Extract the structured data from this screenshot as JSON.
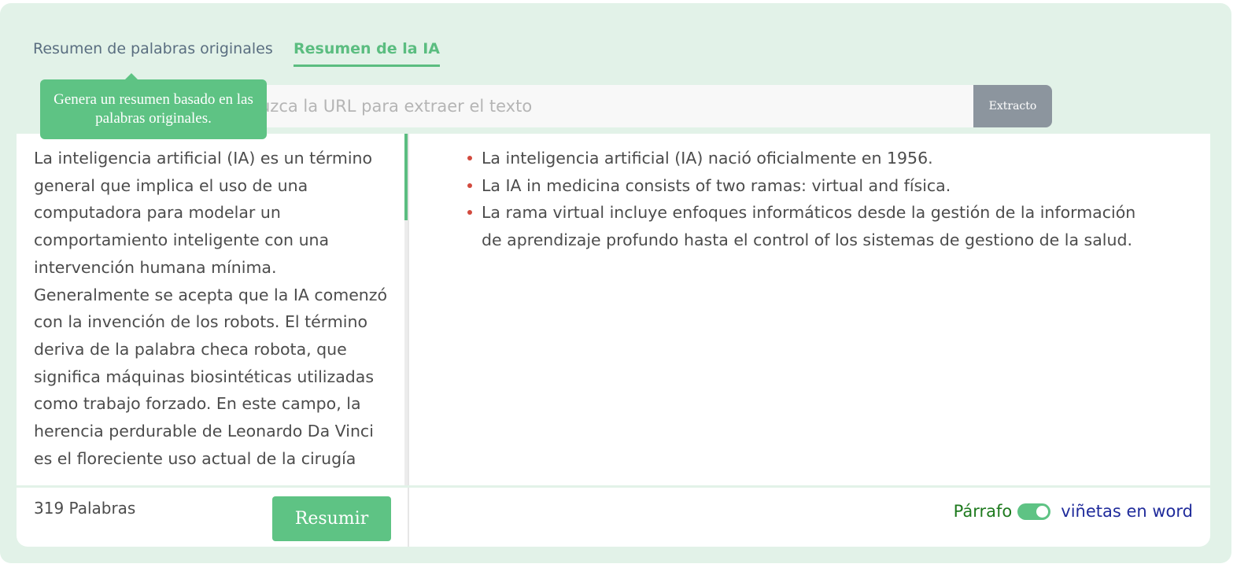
{
  "tabs": {
    "original_label": "Resumen de palabras originales",
    "ai_label": "Resumen de la IA",
    "active": "Resumen de la IA"
  },
  "tooltip": {
    "text": "Genera un resumen basado en las palabras originales."
  },
  "url_bar": {
    "placeholder": "uzca la URL para extraer el texto",
    "value": "",
    "extract_label": "Extracto"
  },
  "original": {
    "text": "La inteligencia artificial (IA) es un término general que implica el uso de una computadora para modelar un comportamiento inteligente con una intervención humana mínima. Generalmente se acepta que la IA comenzó con la invención de los robots. El término deriva de la palabra checa robota, que significa máquinas biosintéticas utilizadas como trabajo forzado. En este campo, la herencia perdurable de Leonardo Da Vinci es el floreciente uso actual de la cirugía",
    "word_count": "319 Palabras",
    "summarize_label": "Resumir"
  },
  "summary": {
    "items": [
      "La inteligencia artificial (IA) nació oficialmente en 1956.",
      "La IA in medicina consists of two ramas: virtual and física.",
      "La rama virtual incluye enfoques informáticos desde la gestión de la información de aprendizaje profundo hasta el control of los sistemas de gestiono de la salud."
    ]
  },
  "format_toggle": {
    "left_label": "Párrafo",
    "right_label": "viñetas en word",
    "state": "on"
  },
  "colors": {
    "panel_bg": "#e2f2e8",
    "accent_green": "#5ec384",
    "extract_button": "#8c959e",
    "bullet_red": "#d24a3e",
    "paragraph_label": "#1e7a1e",
    "bullets_label": "#1f2b9b"
  }
}
